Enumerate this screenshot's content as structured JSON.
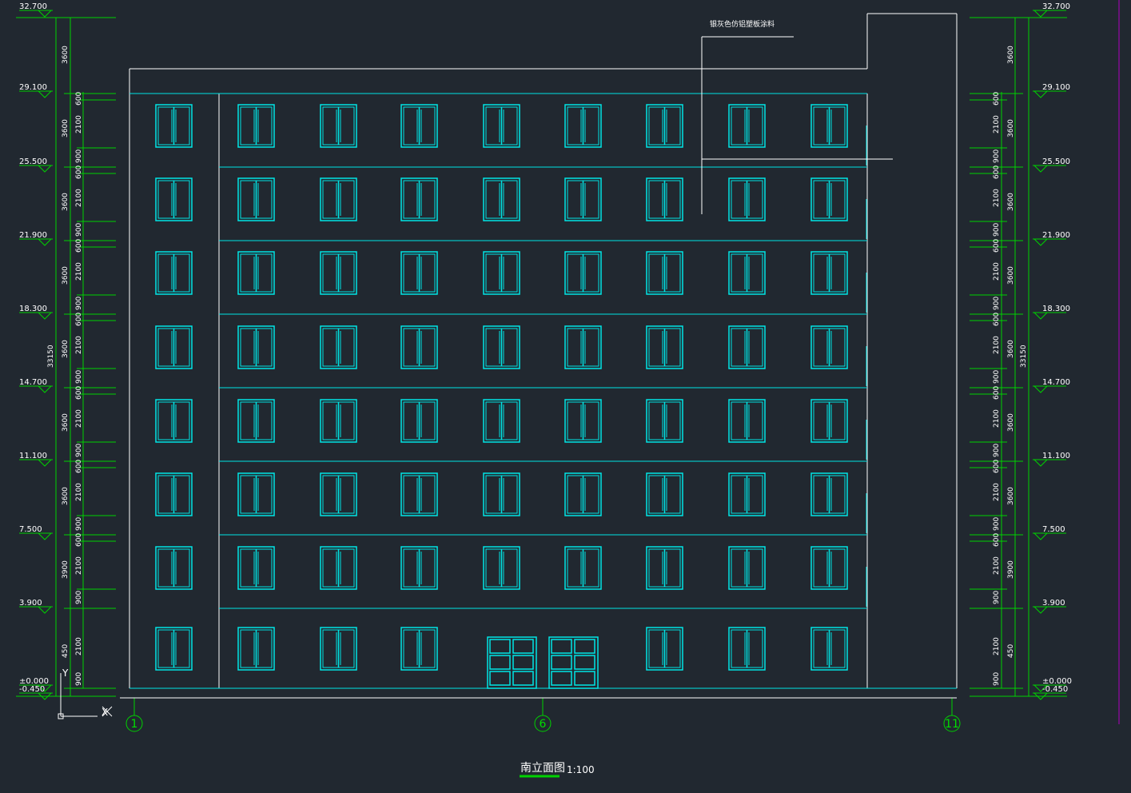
{
  "title": "南立面图",
  "scale": "1:100",
  "note": "银灰色仿铝塑板涂料",
  "colors": {
    "background": "#212830",
    "outline": "#ffffff",
    "window": "#00e5e5",
    "dimension": "#00d200",
    "magenta": "#b000c0"
  },
  "axes": [
    "1",
    "6",
    "11"
  ],
  "levels": [
    "32.700",
    "29.100",
    "25.500",
    "21.900",
    "18.300",
    "14.700",
    "11.100",
    "7.500",
    "3.900",
    "±0.000",
    "-0.450"
  ],
  "total_height": "33150",
  "floor_dims_left": [
    "3600",
    "3600",
    "3600",
    "3600",
    "3600",
    "3600",
    "3600",
    "3900",
    "450"
  ],
  "floor_dims_right": [
    "3600",
    "3600",
    "3600",
    "3600",
    "3600",
    "3600",
    "3600",
    "3900",
    "450"
  ],
  "detail_dims": [
    "600",
    "2100",
    "900"
  ],
  "ground_detail_dims": [
    "2100",
    "900"
  ],
  "ucs": {
    "x": "X",
    "y": "Y"
  }
}
